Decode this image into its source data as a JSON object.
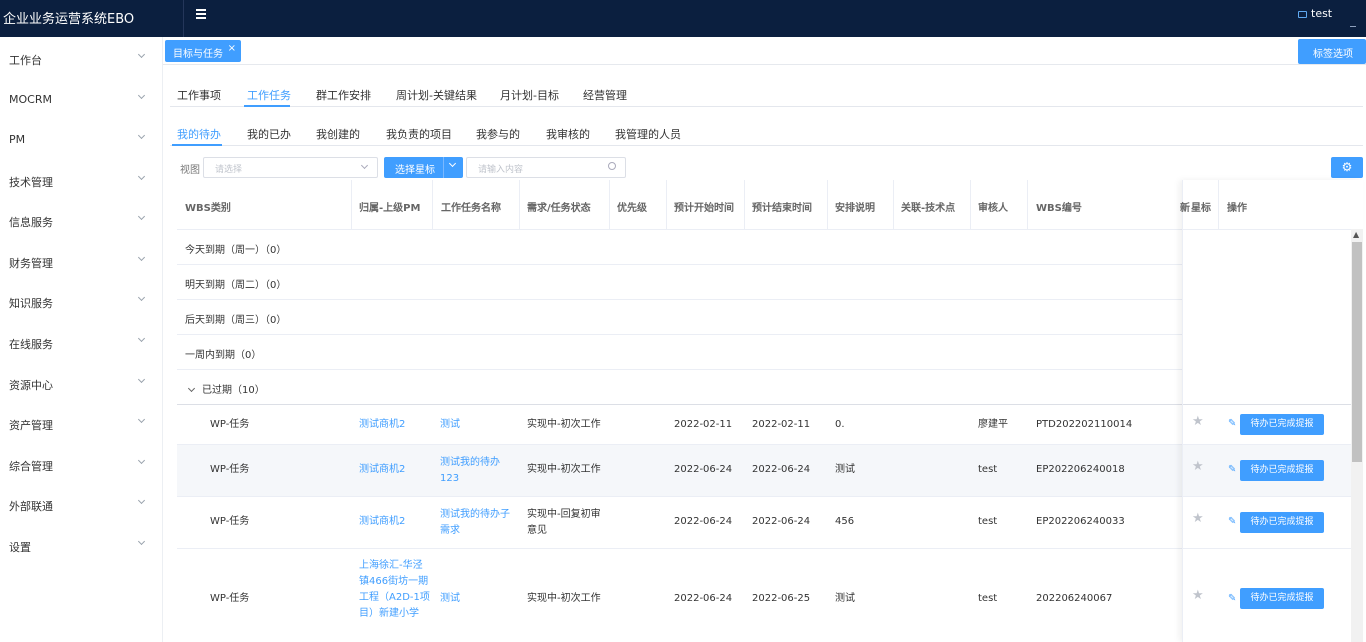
{
  "app": {
    "title": "企业业务运营系统EBO",
    "user": "test"
  },
  "sidebar": {
    "items": [
      {
        "label": "工作台"
      },
      {
        "label": "MOCRM"
      },
      {
        "label": "PM"
      },
      {
        "label": "技术管理"
      },
      {
        "label": "信息服务"
      },
      {
        "label": "财务管理"
      },
      {
        "label": "知识服务"
      },
      {
        "label": "在线服务"
      },
      {
        "label": "资源中心"
      },
      {
        "label": "资产管理"
      },
      {
        "label": "综合管理"
      },
      {
        "label": "外部联通"
      },
      {
        "label": "设置"
      }
    ]
  },
  "tabstrip": {
    "active_tab": "目标与任务",
    "close": "×",
    "options_label": "标签选项"
  },
  "primary_tabs": [
    {
      "label": "工作事项",
      "active": false
    },
    {
      "label": "工作任务",
      "active": true
    },
    {
      "label": "群工作安排",
      "active": false
    },
    {
      "label": "周计划-关键结果",
      "active": false
    },
    {
      "label": "月计划-目标",
      "active": false
    },
    {
      "label": "经营管理",
      "active": false
    }
  ],
  "secondary_tabs": [
    {
      "label": "我的待办",
      "active": true
    },
    {
      "label": "我的已办",
      "active": false
    },
    {
      "label": "我创建的",
      "active": false
    },
    {
      "label": "我负责的项目",
      "active": false
    },
    {
      "label": "我参与的",
      "active": false
    },
    {
      "label": "我审核的",
      "active": false
    },
    {
      "label": "我管理的人员",
      "active": false
    }
  ],
  "filters": {
    "view_label": "视图",
    "view_placeholder": "请选择",
    "star_button": "选择星标",
    "search_placeholder": "请输入内容",
    "settings_icon": "gear-icon"
  },
  "table": {
    "columns": [
      "WBS类别",
      "归属-上级PM",
      "工作任务名称",
      "需求/任务状态",
      "优先级",
      "预计开始时间",
      "预计结束时间",
      "安排说明",
      "关联-技术点",
      "审核人",
      "WBS编号",
      "星标",
      "操作"
    ],
    "overflow_col": "新",
    "groups": [
      {
        "label": "今天到期（周一）（0）"
      },
      {
        "label": "明天到期（周二）（0）"
      },
      {
        "label": "后天到期（周三）（0）"
      },
      {
        "label": "一周内到期（0）"
      },
      {
        "label": "已过期（10）"
      }
    ],
    "rows": [
      {
        "wbs_type": "WP-任务",
        "pm": "测试商机2",
        "name": "测试",
        "status": "实现中-初次工作",
        "priority": "",
        "start": "2022-02-11",
        "end": "2022-02-11",
        "note": "0.",
        "tech": "",
        "reviewer": "廖建平",
        "wbs_no": "PTD202202110014"
      },
      {
        "wbs_type": "WP-任务",
        "pm": "测试商机2",
        "name": "测试我的待办123",
        "status": "实现中-初次工作",
        "priority": "",
        "start": "2022-06-24",
        "end": "2022-06-24",
        "note": "测试",
        "tech": "",
        "reviewer": "test",
        "wbs_no": "EP202206240018"
      },
      {
        "wbs_type": "WP-任务",
        "pm": "测试商机2",
        "name": "测试我的待办子需求",
        "status": "实现中-回复初审意见",
        "priority": "",
        "start": "2022-06-24",
        "end": "2022-06-24",
        "note": "456",
        "tech": "",
        "reviewer": "test",
        "wbs_no": "EP202206240033"
      },
      {
        "wbs_type": "WP-任务",
        "pm": "上海徐汇-华泾镇466街坊一期工程（A2D-1项目）新建小学",
        "name": "测试",
        "status": "实现中-初次工作",
        "priority": "",
        "start": "2022-06-24",
        "end": "2022-06-25",
        "note": "测试",
        "tech": "",
        "reviewer": "test",
        "wbs_no": "202206240067"
      }
    ],
    "action_label": "待办已完成提报"
  }
}
